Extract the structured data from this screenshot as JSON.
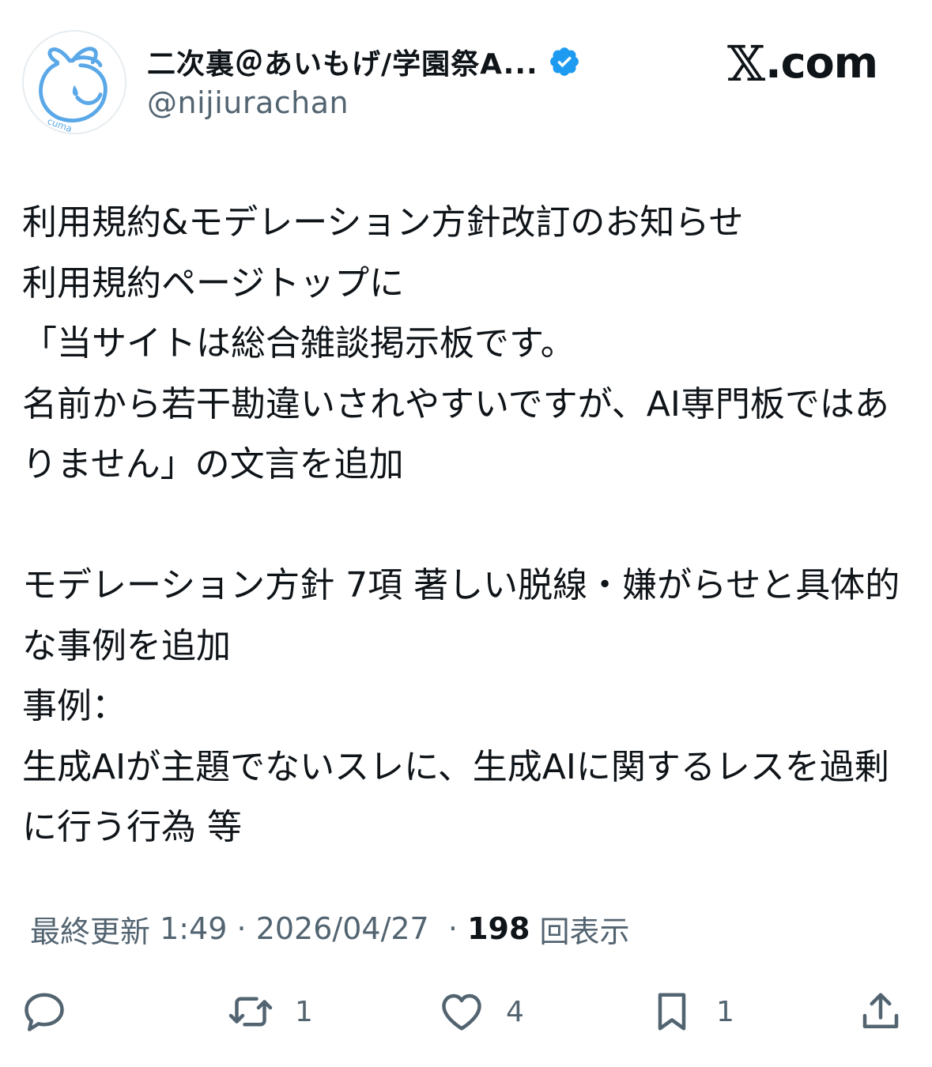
{
  "author": {
    "display_name": "二次裏＠あいもげ/学園祭A...",
    "handle": "@nijiurachan",
    "avatar_icon": "sprout-face-avatar-icon",
    "avatar_text": "cuma",
    "verified_icon": "verified-badge-icon",
    "verified_color": "#1d9bf0"
  },
  "brand": {
    "prefix": "𝕏",
    "label": ".com"
  },
  "tweet": {
    "text": "利用規約&モデレーション方針改訂のお知らせ\n利用規約ページトップに\n「当サイトは総合雑談掲示板です。\n名前から若干勘違いされやすいですが、AI専門板ではありません」の文言を追加\n\nモデレーション方針 7項 著しい脱線・嫌がらせと具体的な事例を追加\n事例：\n生成AIが主題でないスレに、生成AIに関するレスを過剰に行う行為  等"
  },
  "meta": {
    "updated_label": "最終更新",
    "time": "1:49",
    "date": "2026/04/27",
    "views_count": "198",
    "views_label": "回表示"
  },
  "actions": {
    "reply": {
      "icon": "reply-icon",
      "count": ""
    },
    "retweet": {
      "icon": "retweet-icon",
      "count": "1"
    },
    "like": {
      "icon": "heart-icon",
      "count": "4"
    },
    "bookmark": {
      "icon": "bookmark-icon",
      "count": "1"
    },
    "share": {
      "icon": "share-icon"
    }
  },
  "colors": {
    "text": "#0f1419",
    "secondary": "#536471",
    "accent": "#1d9bf0",
    "avatar_line": "#5aa8e8"
  }
}
